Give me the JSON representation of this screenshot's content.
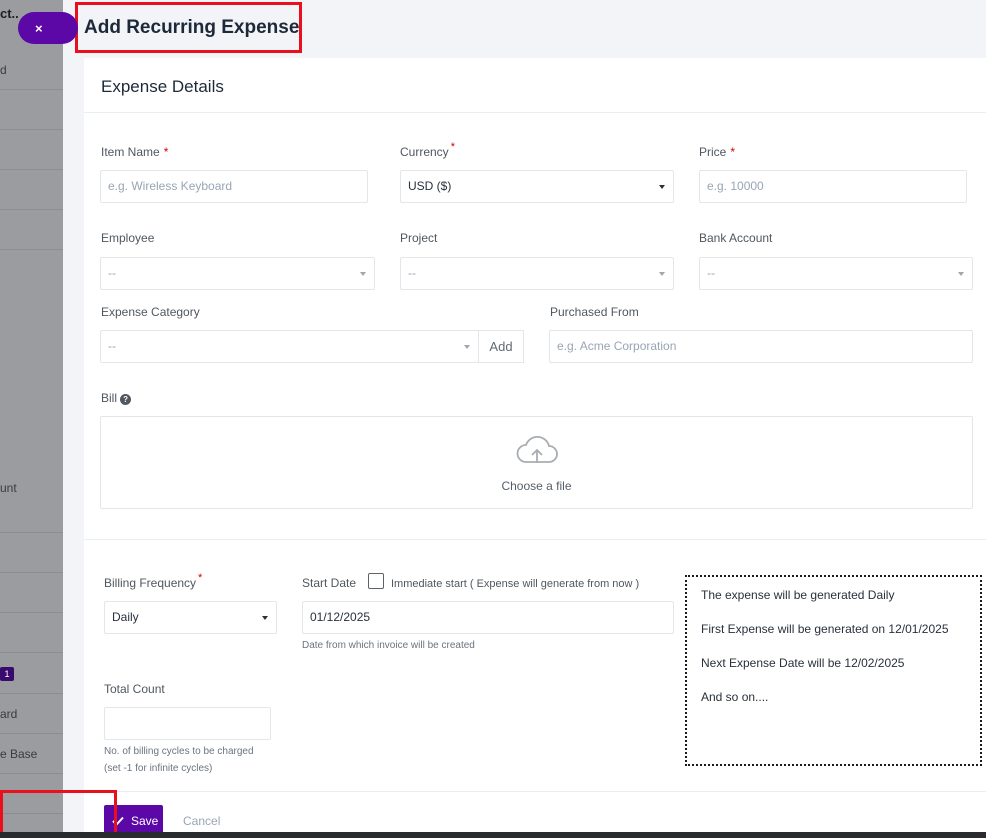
{
  "background": {
    "top_text": "ct..",
    "rows": [
      "d",
      "",
      "",
      "",
      "",
      "",
      "",
      "",
      "unt",
      "",
      "",
      "",
      "",
      "ard",
      "e Base",
      ""
    ],
    "badge": "1"
  },
  "close_button": "×",
  "panel_title": "Add Recurring Expense",
  "section_title": "Expense Details",
  "fields": {
    "item_name": {
      "label": "Item Name",
      "required": "*",
      "placeholder": "e.g. Wireless Keyboard"
    },
    "currency": {
      "label": "Currency",
      "required": "*",
      "value": "USD ($)"
    },
    "price": {
      "label": "Price",
      "required": "*",
      "placeholder": "e.g. 10000"
    },
    "employee": {
      "label": "Employee",
      "value": "--"
    },
    "project": {
      "label": "Project",
      "value": "--"
    },
    "bank_account": {
      "label": "Bank Account",
      "value": "--"
    },
    "expense_category": {
      "label": "Expense Category",
      "value": "--",
      "add_label": "Add"
    },
    "purchased_from": {
      "label": "Purchased From",
      "placeholder": "e.g. Acme Corporation"
    },
    "bill": {
      "label": "Bill",
      "help_icon": "?",
      "dropzone_text": "Choose a file"
    }
  },
  "recurring": {
    "billing_frequency": {
      "label": "Billing Frequency",
      "required": "*",
      "value": "Daily"
    },
    "start_date": {
      "label": "Start Date",
      "value": "01/12/2025",
      "hint": "Date from which invoice will be created"
    },
    "immediate_start": {
      "label": "Immediate start ( Expense will generate from now )"
    },
    "total_count": {
      "label": "Total Count",
      "value": "",
      "hint_line1": "No. of billing cycles to be charged",
      "hint_line2": "(set -1 for infinite cycles)"
    },
    "info": {
      "line1": "The expense will be generated Daily",
      "line2": "First Expense will be generated on 12/01/2025",
      "line3": "Next Expense Date will be 12/02/2025",
      "line4": "And so on...."
    }
  },
  "footer": {
    "save_label": "Save",
    "cancel_label": "Cancel"
  },
  "colors": {
    "accent": "#5b08a7",
    "highlight": "#e8101c",
    "required": "#d30000"
  },
  "icons": [
    "close-icon",
    "help-icon",
    "cloud-upload-icon",
    "checkmark-icon",
    "caret-down-icon"
  ]
}
